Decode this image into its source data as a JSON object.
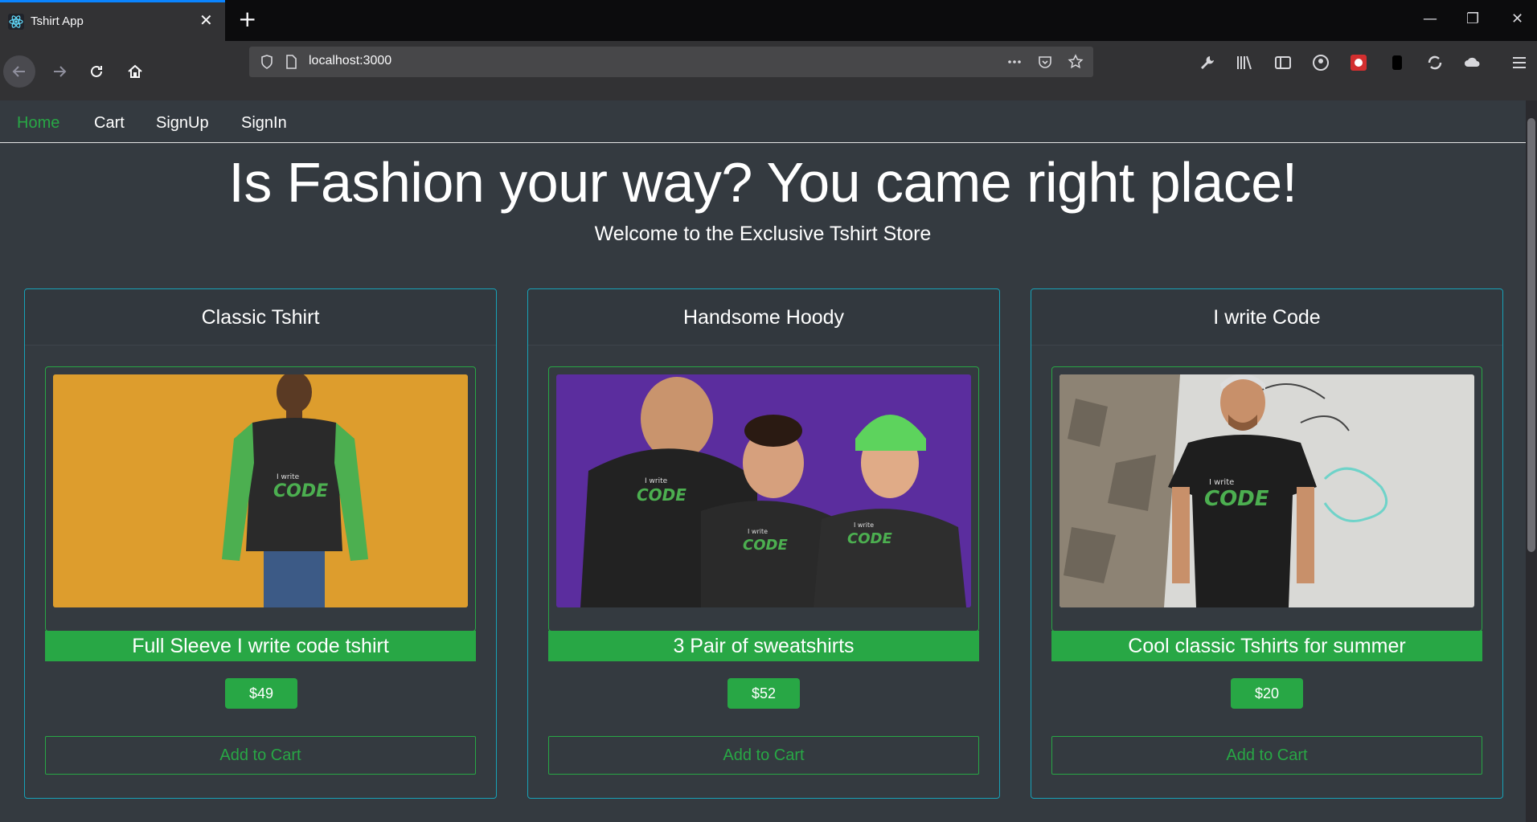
{
  "browser": {
    "tab_title": "Tshirt App",
    "url": "localhost:3000"
  },
  "nav": {
    "items": [
      {
        "label": "Home",
        "active": true
      },
      {
        "label": "Cart",
        "active": false
      },
      {
        "label": "SignUp",
        "active": false
      },
      {
        "label": "SignIn",
        "active": false
      }
    ]
  },
  "hero": {
    "title": "Is Fashion your way? You came right place!",
    "subtitle": "Welcome to the Exclusive Tshirt Store"
  },
  "products": [
    {
      "name": "Classic Tshirt",
      "description": "Full Sleeve I write code tshirt",
      "price": "$49",
      "button": "Add to Cart",
      "image_text_top": "I write",
      "image_text_bottom": "CODE"
    },
    {
      "name": "Handsome Hoody",
      "description": "3 Pair of sweatshirts",
      "price": "$52",
      "button": "Add to Cart",
      "image_text_top": "I write",
      "image_text_bottom": "CODE"
    },
    {
      "name": "I write Code",
      "description": "Cool classic Tshirts for summer",
      "price": "$20",
      "button": "Add to Cart",
      "image_text_top": "I write",
      "image_text_bottom": "CODE"
    }
  ],
  "colors": {
    "accent": "#28a745",
    "card_border": "#17a2b8",
    "page_bg": "#343a40"
  }
}
